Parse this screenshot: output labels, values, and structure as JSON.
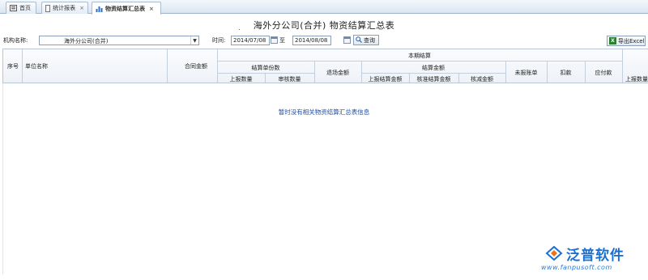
{
  "tabs": [
    {
      "label": "首页",
      "icon": "home-icon",
      "close": ""
    },
    {
      "label": "统计报表",
      "icon": "report-icon",
      "close": "×"
    },
    {
      "label": "物资结算汇总表",
      "icon": "chart-icon",
      "close": "×"
    }
  ],
  "title": "海外分公司(合并) 物资结算汇总表",
  "filter": {
    "org_label": "机构名称:",
    "org_value": "海外分公司(合并)",
    "time_label": "时间:",
    "date_from": "2014/07/08",
    "to_label": "至",
    "date_to": "2014/08/08",
    "query_label": "查询",
    "export_label": "导出Excel"
  },
  "columns": {
    "seq": "序号",
    "unit_name": "单位名称",
    "contract_amount": "合同金额",
    "current_settle": "本期结算",
    "settle_doc_count": "结算单份数",
    "reported_count": "上报数量",
    "reviewed_count": "审核数量",
    "return_amount": "退场金额",
    "settle_amount": "结算金额",
    "reported_settle": "上报结算金额",
    "approved_settle": "核准结算金额",
    "deducted_amount": "核减金额",
    "unreported": "未报账单",
    "deduction": "扣款",
    "payable": "应付款",
    "reported_qty_2": "上报数量"
  },
  "empty_message": "暂时没有相关物资结算汇总表信息",
  "watermark": {
    "brand": "泛普软件",
    "url": "www.fanpusoft.com"
  }
}
